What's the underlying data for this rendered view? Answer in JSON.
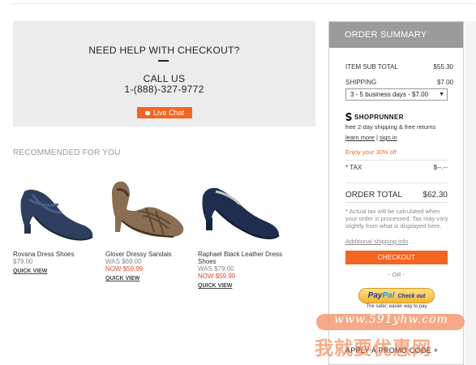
{
  "help": {
    "title": "NEED HELP WITH CHECKOUT?",
    "call_label": "CALL US",
    "phone": "1-(888)-327-9772",
    "chat_label": "Live Chat"
  },
  "recommended": {
    "title": "RECOMMENDED FOR YOU",
    "products": [
      {
        "name": "Rovana Dress Shoes",
        "price": "$79.00",
        "was": "",
        "now": "",
        "quick_view": "QUICK VIEW"
      },
      {
        "name": "Glover Dressy Sandals",
        "price": "",
        "was": "WAS $69.00",
        "now": "NOW $59.99",
        "quick_view": "QUICK VIEW"
      },
      {
        "name": "Raphael Black Leather Dress Shoes",
        "price": "",
        "was": "WAS $79.00",
        "now": "NOW $59.99",
        "quick_view": "QUICK VIEW"
      }
    ]
  },
  "summary": {
    "title": "ORDER SUMMARY",
    "subtotal_label": "ITEM SUB TOTAL",
    "subtotal_value": "$55.30",
    "shipping_label": "SHIPPING",
    "shipping_value": "$7.00",
    "shipping_option": "3 - 5 business days - $7.00",
    "shoprunner": {
      "brand": "SHOPRUNNER",
      "desc": "free 2-day shipping & free returns",
      "learn_more": "learn more",
      "separator": "|",
      "sign_in": "sign in"
    },
    "offer": "Enjoy your 30% off",
    "tax_label": "* TAX",
    "tax_value": "$--.--",
    "total_label": "ORDER TOTAL",
    "total_value": "$62.30",
    "note": "* Actual tax will be calculated when your order is processed. Tax may vary slightly from what is displayed here.",
    "shipping_info": "Additional shipping info",
    "checkout": "CHECKOUT",
    "or": "- OR -",
    "paypal_tagline": "The safer, easier way to pay",
    "promo": "APPLY A PROMO CODE +"
  },
  "watermark": {
    "url": "www.591yhw.com",
    "cn": "我就要优惠网"
  },
  "colors": {
    "accent": "#f26522",
    "summary_header": "#9b9b9b",
    "help_bg": "#ececec"
  }
}
